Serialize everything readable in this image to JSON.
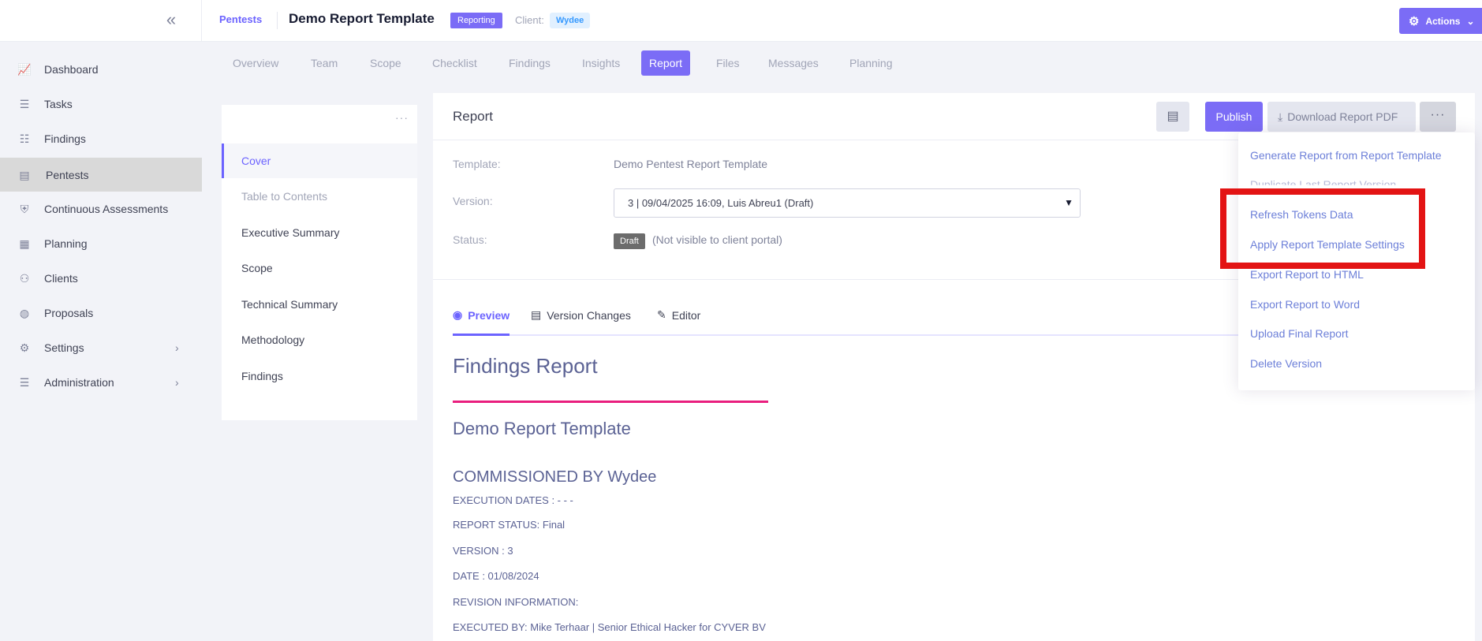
{
  "header": {
    "breadcrumb": "Pentests",
    "title": "Demo Report Template",
    "status_badge": "Reporting",
    "client_label": "Client:",
    "client_name": "Wydee",
    "actions_label": "Actions"
  },
  "sidebar": {
    "items": [
      {
        "label": "Dashboard",
        "icon": "chart-icon"
      },
      {
        "label": "Tasks",
        "icon": "list-icon"
      },
      {
        "label": "Findings",
        "icon": "checklist-icon"
      },
      {
        "label": "Pentests",
        "icon": "folder-icon",
        "active": true
      },
      {
        "label": "Continuous Assessments",
        "icon": "shield-icon"
      },
      {
        "label": "Planning",
        "icon": "calendar-icon"
      },
      {
        "label": "Clients",
        "icon": "users-icon"
      },
      {
        "label": "Proposals",
        "icon": "stack-icon"
      },
      {
        "label": "Settings",
        "icon": "gear-icon",
        "expandable": true
      },
      {
        "label": "Administration",
        "icon": "sliders-icon",
        "expandable": true
      }
    ]
  },
  "tabs": [
    "Overview",
    "Team",
    "Scope",
    "Checklist",
    "Findings",
    "Insights",
    "Report",
    "Files",
    "Messages",
    "Planning"
  ],
  "active_tab": "Report",
  "outline": {
    "items": [
      "Cover",
      "Table to Contents",
      "Executive Summary",
      "Scope",
      "Technical Summary",
      "Methodology",
      "Findings"
    ],
    "active": "Cover"
  },
  "report_card": {
    "title": "Report",
    "publish_label": "Publish",
    "download_label": "Download Report PDF",
    "template_label": "Template:",
    "template_value": "Demo Pentest Report Template",
    "version_label": "Version:",
    "version_value": "3 | 09/04/2025 16:09, Luis Abreu1 (Draft)",
    "status_label": "Status:",
    "status_badge": "Draft",
    "status_note": "(Not visible to client portal)",
    "sub_tabs": [
      "Preview",
      "Version Changes",
      "Editor"
    ]
  },
  "preview": {
    "h1": "Findings Report",
    "h2": "Demo Report Template",
    "h3": "COMMISSIONED BY Wydee",
    "lines": [
      "EXECUTION DATES : - - -",
      "REPORT STATUS: Final",
      "VERSION : 3",
      "DATE : 01/08/2024",
      "REVISION INFORMATION:",
      "EXECUTED BY: Mike Terhaar | Senior Ethical Hacker for CYVER BV"
    ]
  },
  "dropdown": {
    "items": [
      "Generate Report from Report Template",
      "Duplicate Last Report Version",
      "Refresh Tokens Data",
      "Apply Report Template Settings",
      "Export Report to HTML",
      "Export Report to Word",
      "Upload Final Report",
      "Delete Version"
    ]
  },
  "colors": {
    "accent": "#7b6cf6",
    "highlight": "#e31414",
    "rule": "#e91e7e"
  }
}
